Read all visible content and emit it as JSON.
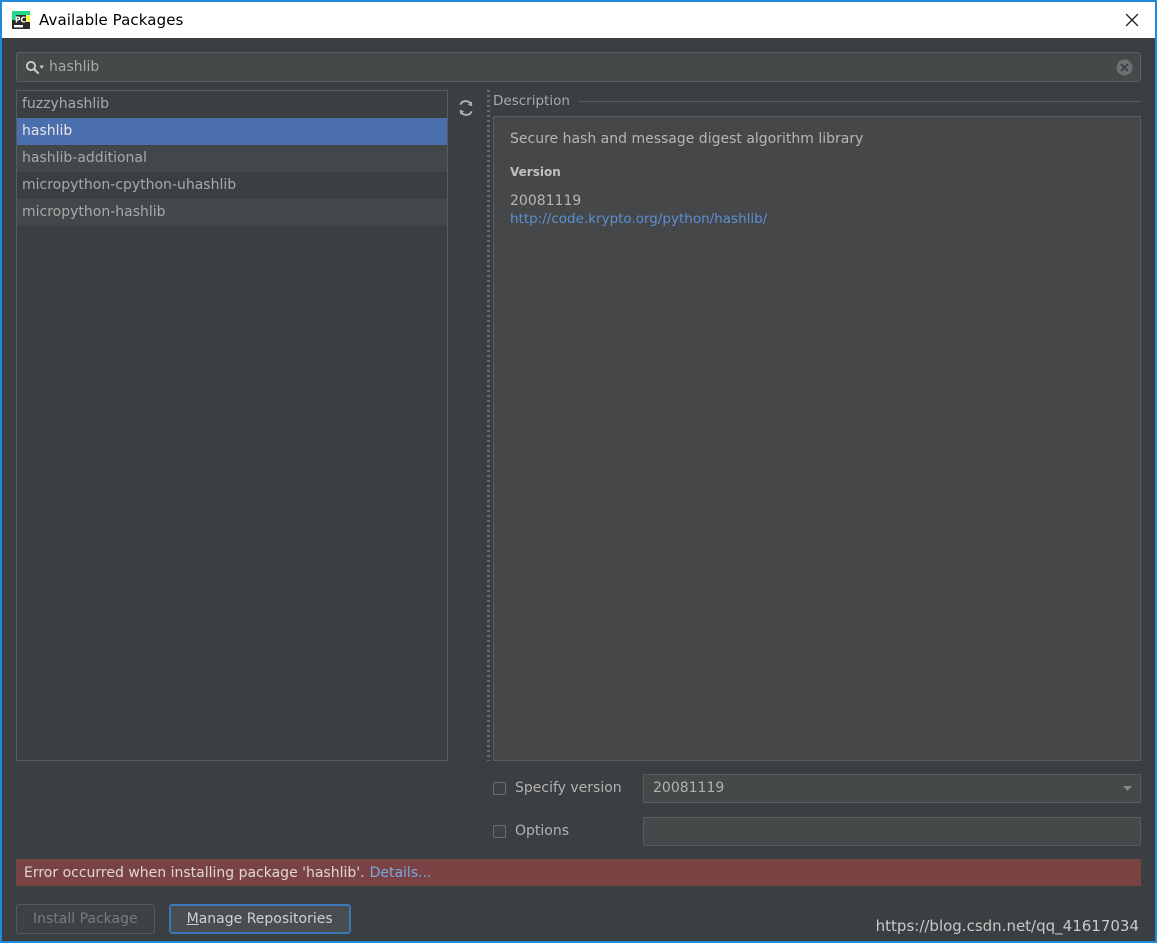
{
  "window": {
    "title": "Available Packages",
    "app_icon": "pycharm-icon",
    "close_icon": "close-icon",
    "border_color": "#1f8ad8",
    "titlebar_bg": "#ffffff",
    "body_bg": "#3c3f41"
  },
  "search": {
    "icon": "search-icon",
    "value": "hashlib",
    "placeholder": "",
    "clear_icon": "clear-circle-icon"
  },
  "package_list": {
    "refresh_icon": "refresh-icon",
    "selected_index": 1,
    "items": [
      "fuzzyhashlib",
      "hashlib",
      "hashlib-additional",
      "micropython-cpython-uhashlib",
      "micropython-hashlib"
    ]
  },
  "description": {
    "header": "Description",
    "summary": "Secure hash and message digest algorithm library",
    "version_label": "Version",
    "version_value": "20081119",
    "link": "http://code.krypto.org/python/hashlib/",
    "link_color": "#5b90d4"
  },
  "options": {
    "specify_version": {
      "label": "Specify version",
      "checked": false,
      "value": "20081119",
      "arrow_icon": "chevron-down-icon"
    },
    "options_flag": {
      "label": "Options",
      "checked": false,
      "value": ""
    }
  },
  "error": {
    "message": "Error occurred when installing package 'hashlib'.",
    "link": "Details...",
    "bg_color": "#7a4343",
    "link_color": "#7ba7e0"
  },
  "footer": {
    "install_button": {
      "label": "Install Package",
      "enabled": false
    },
    "manage_button": {
      "label_prefix": "",
      "mnemonic": "M",
      "label_rest": "anage Repositories",
      "focused": true,
      "focus_color": "#3b78b8"
    },
    "watermark": "https://blog.csdn.net/qq_41617034"
  }
}
